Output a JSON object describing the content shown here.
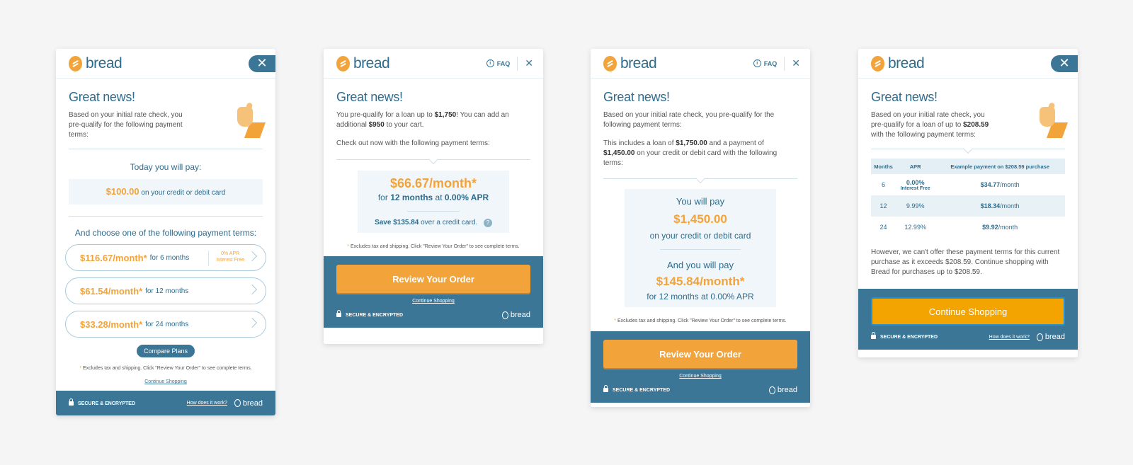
{
  "brand": {
    "name": "bread",
    "footer_logo": "bread",
    "colors": {
      "primary": "#3b7697",
      "accent": "#f2a33a",
      "background": "#f5f5f5"
    }
  },
  "icons": {
    "close": "close-icon",
    "info": "info-icon",
    "lock": "lock-icon",
    "chevron": "chevron-right-icon",
    "help": "help-icon"
  },
  "card1": {
    "close": "✕",
    "title": "Great news!",
    "intro": "Based on your initial rate check, you pre-qualify for the following payment terms:",
    "today_label": "Today you will pay:",
    "today_amount": "$100.00",
    "today_suffix": "on your credit or debit card",
    "choose_label": "And choose one of the following payment terms:",
    "plans": [
      {
        "amount": "$116.67/month*",
        "term": "for 6 months",
        "apr_line1": "0% APR",
        "apr_line2": "Interest Free"
      },
      {
        "amount": "$61.54/month*",
        "term": "for 12 months"
      },
      {
        "amount": "$33.28/month*",
        "term": "for 24 months"
      }
    ],
    "compare": "Compare Plans",
    "note_star": "*",
    "note": "Excludes tax and shipping. Click \"Review Your Order\" to see complete terms.",
    "continue": "Continue Shopping",
    "secure": "SECURE & ENCRYPTED",
    "how": "How does it work?"
  },
  "card2": {
    "faq": "FAQ",
    "close": "✕",
    "title": "Great news!",
    "p1_a": "You pre-qualify for a loan up to ",
    "p1_b": "$1,750",
    "p1_c": "! You can add an additional ",
    "p1_d": "$950",
    "p1_e": " to your cart.",
    "p2": "Check out now with the following payment terms:",
    "monthly": "$66.67/month*",
    "for": "for ",
    "months": "12 months",
    "at": " at ",
    "apr": "0.00% APR",
    "save_a": "Save $135.84",
    "save_b": " over a credit card.",
    "help": "?",
    "note_star": "*",
    "note": "Excludes tax and shipping. Click \"Review Your Order\" to see complete terms.",
    "button": "Review Your Order",
    "continue": "Continue Shopping",
    "secure": "SECURE & ENCRYPTED"
  },
  "card3": {
    "faq": "FAQ",
    "close": "✕",
    "title": "Great news!",
    "p1": "Based on your initial rate check, you pre-qualify for the following payment terms:",
    "p2_a": "This includes a loan of ",
    "p2_b": "$1,750.00",
    "p2_c": " and a payment of ",
    "p2_d": "$1,450.00",
    "p2_e": " on your credit or debit card with the following terms:",
    "you_pay": "You will pay",
    "pay_amount": "$1,450.00",
    "pay_sub": "on your credit or debit card",
    "and_pay": "And you will pay",
    "monthly": "$145.84/month*",
    "monthly_sub": "for 12 months at 0.00% APR",
    "note_star": "*",
    "note": "Excludes tax and shipping. Click \"Review Your Order\" to see complete terms.",
    "button": "Review Your Order",
    "continue": "Continue Shopping",
    "secure": "SECURE & ENCRYPTED"
  },
  "card4": {
    "close": "✕",
    "title": "Great news!",
    "intro_a": "Based on your initial rate check, you pre-qualify for a loan of up to ",
    "intro_b": "$208.59",
    "intro_c": " with the following payment terms:",
    "headers": [
      "Months",
      "APR",
      "Example payment on $208.59 purchase"
    ],
    "rows": [
      {
        "months": "6",
        "apr": "0.00%",
        "apr_sub": "Interest Free",
        "pay": "$34.77",
        "per": "/month"
      },
      {
        "months": "12",
        "apr": "9.99%",
        "apr_sub": "",
        "pay": "$18.34",
        "per": "/month"
      },
      {
        "months": "24",
        "apr": "12.99%",
        "apr_sub": "",
        "pay": "$9.92",
        "per": "/month"
      }
    ],
    "warning": "However, we can't offer these payment terms for this current purchase as it exceeds $208.59. Continue shopping with Bread for purchases up to $208.59.",
    "button": "Continue Shopping",
    "secure": "SECURE & ENCRYPTED",
    "how": "How does it work?"
  }
}
